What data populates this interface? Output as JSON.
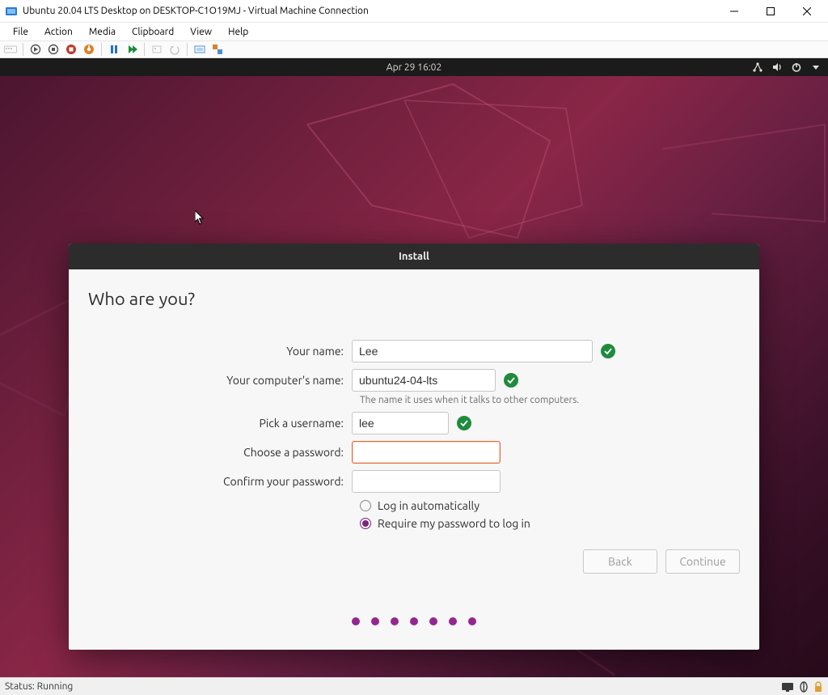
{
  "window_title": "Ubuntu 20.04 LTS Desktop on DESKTOP-C1O19MJ - Virtual Machine Connection",
  "menubar": [
    "File",
    "Action",
    "Media",
    "Clipboard",
    "View",
    "Help"
  ],
  "topbar_datetime": "Apr 29  16:02",
  "installer": {
    "title": "Install",
    "heading": "Who are you?",
    "fields": {
      "name_label": "Your name:",
      "name_value": "Lee",
      "computer_label": "Your computer's name:",
      "computer_value": "ubuntu24-04-lts",
      "computer_helper": "The name it uses when it talks to other computers.",
      "username_label": "Pick a username:",
      "username_value": "lee",
      "password_label": "Choose a password:",
      "password_value": "",
      "confirm_label": "Confirm your password:",
      "confirm_value": ""
    },
    "radios": {
      "auto_login": "Log in automatically",
      "require_pw": "Require my password to log in"
    },
    "buttons": {
      "back": "Back",
      "continue": "Continue"
    }
  },
  "status_text": "Status: Running"
}
